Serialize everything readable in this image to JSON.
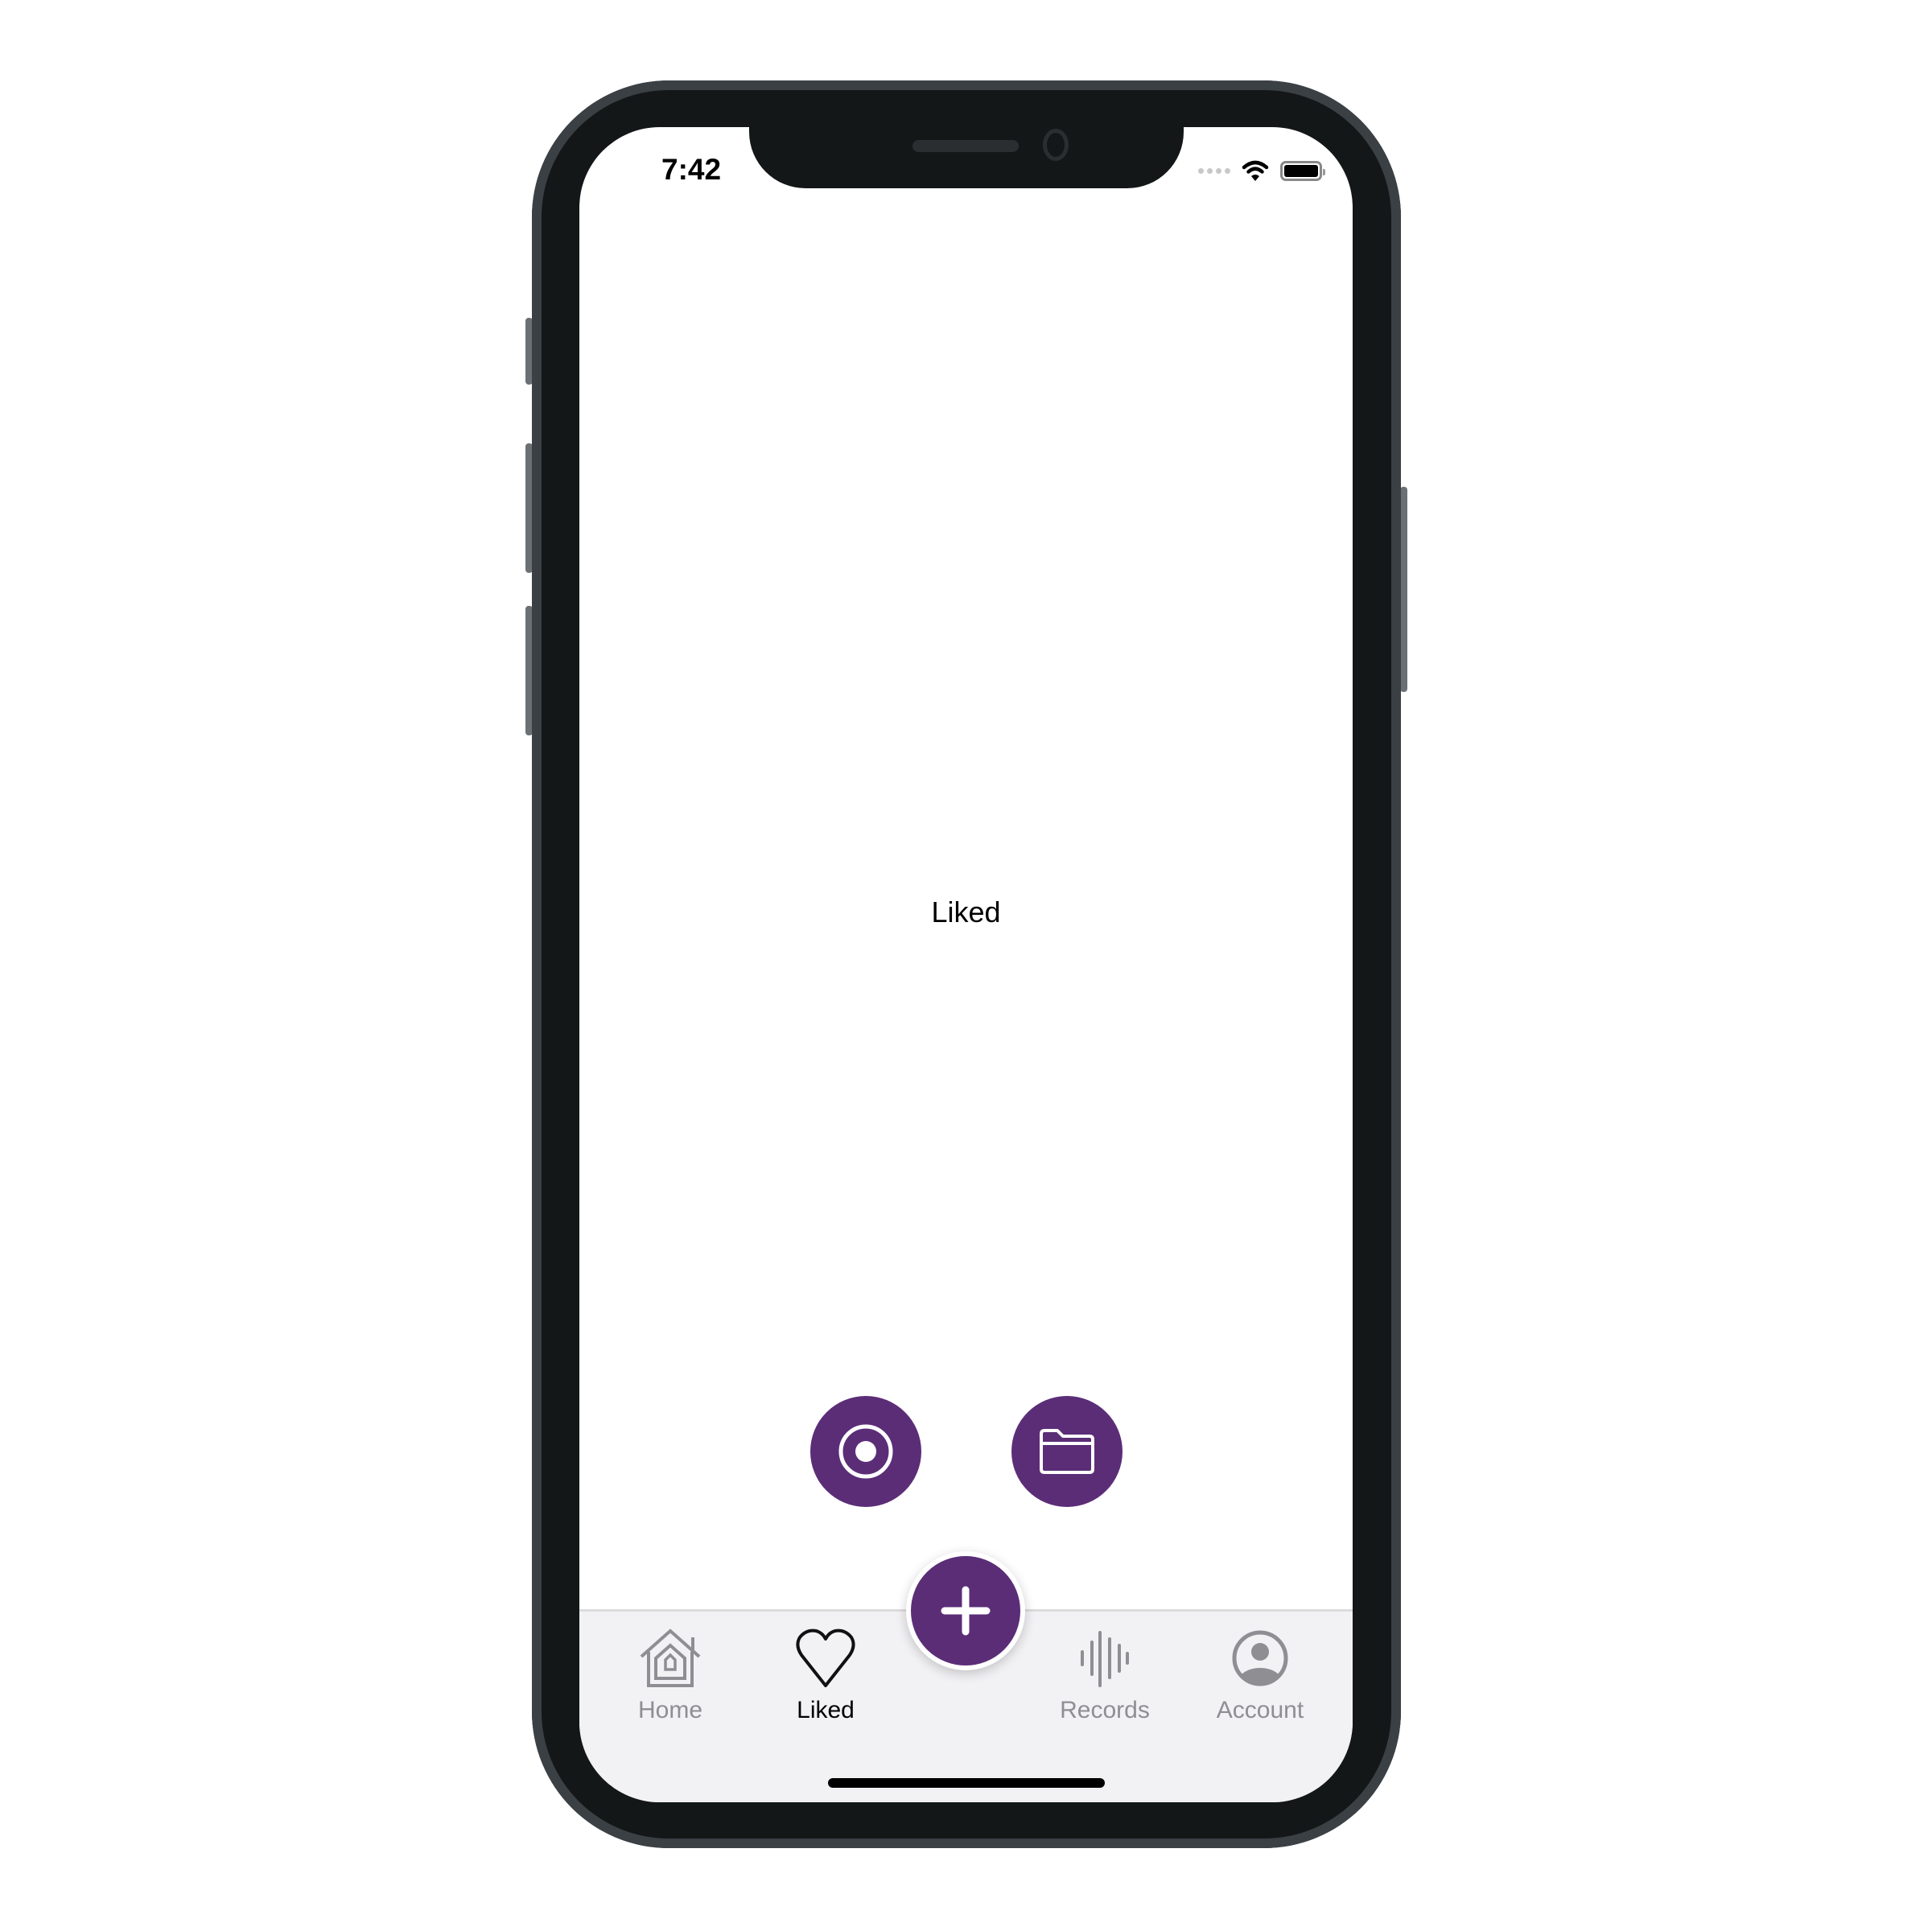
{
  "status_bar": {
    "time": "7:42"
  },
  "main": {
    "title": "Liked"
  },
  "actions": [
    {
      "icon": "record-icon"
    },
    {
      "icon": "folder-icon"
    }
  ],
  "fab": {
    "icon": "plus-icon"
  },
  "tabs": [
    {
      "label": "Home",
      "icon": "home-icon",
      "active": false
    },
    {
      "label": "Liked",
      "icon": "heart-icon",
      "active": true
    },
    {
      "label": "Records",
      "icon": "waveform-icon",
      "active": false
    },
    {
      "label": "Account",
      "icon": "account-icon",
      "active": false
    }
  ],
  "colors": {
    "accent": "#5b2d77",
    "tab_inactive": "#8e8e93",
    "tab_active": "#000000",
    "tabbar_bg": "#f2f1f4"
  }
}
